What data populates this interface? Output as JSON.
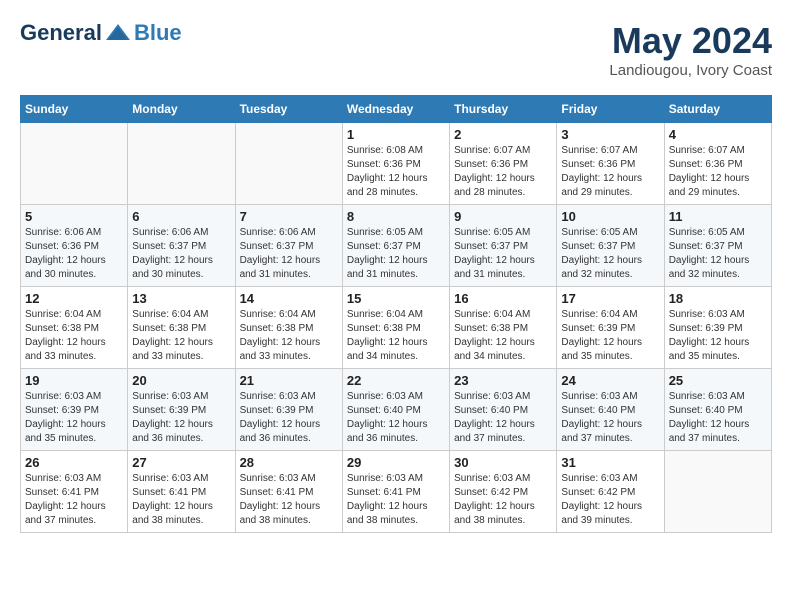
{
  "header": {
    "logo_general": "General",
    "logo_blue": "Blue",
    "month_year": "May 2024",
    "location": "Landiougou, Ivory Coast"
  },
  "days_of_week": [
    "Sunday",
    "Monday",
    "Tuesday",
    "Wednesday",
    "Thursday",
    "Friday",
    "Saturday"
  ],
  "weeks": [
    [
      {
        "day": "",
        "info": ""
      },
      {
        "day": "",
        "info": ""
      },
      {
        "day": "",
        "info": ""
      },
      {
        "day": "1",
        "info": "Sunrise: 6:08 AM\nSunset: 6:36 PM\nDaylight: 12 hours\nand 28 minutes."
      },
      {
        "day": "2",
        "info": "Sunrise: 6:07 AM\nSunset: 6:36 PM\nDaylight: 12 hours\nand 28 minutes."
      },
      {
        "day": "3",
        "info": "Sunrise: 6:07 AM\nSunset: 6:36 PM\nDaylight: 12 hours\nand 29 minutes."
      },
      {
        "day": "4",
        "info": "Sunrise: 6:07 AM\nSunset: 6:36 PM\nDaylight: 12 hours\nand 29 minutes."
      }
    ],
    [
      {
        "day": "5",
        "info": "Sunrise: 6:06 AM\nSunset: 6:36 PM\nDaylight: 12 hours\nand 30 minutes."
      },
      {
        "day": "6",
        "info": "Sunrise: 6:06 AM\nSunset: 6:37 PM\nDaylight: 12 hours\nand 30 minutes."
      },
      {
        "day": "7",
        "info": "Sunrise: 6:06 AM\nSunset: 6:37 PM\nDaylight: 12 hours\nand 31 minutes."
      },
      {
        "day": "8",
        "info": "Sunrise: 6:05 AM\nSunset: 6:37 PM\nDaylight: 12 hours\nand 31 minutes."
      },
      {
        "day": "9",
        "info": "Sunrise: 6:05 AM\nSunset: 6:37 PM\nDaylight: 12 hours\nand 31 minutes."
      },
      {
        "day": "10",
        "info": "Sunrise: 6:05 AM\nSunset: 6:37 PM\nDaylight: 12 hours\nand 32 minutes."
      },
      {
        "day": "11",
        "info": "Sunrise: 6:05 AM\nSunset: 6:37 PM\nDaylight: 12 hours\nand 32 minutes."
      }
    ],
    [
      {
        "day": "12",
        "info": "Sunrise: 6:04 AM\nSunset: 6:38 PM\nDaylight: 12 hours\nand 33 minutes."
      },
      {
        "day": "13",
        "info": "Sunrise: 6:04 AM\nSunset: 6:38 PM\nDaylight: 12 hours\nand 33 minutes."
      },
      {
        "day": "14",
        "info": "Sunrise: 6:04 AM\nSunset: 6:38 PM\nDaylight: 12 hours\nand 33 minutes."
      },
      {
        "day": "15",
        "info": "Sunrise: 6:04 AM\nSunset: 6:38 PM\nDaylight: 12 hours\nand 34 minutes."
      },
      {
        "day": "16",
        "info": "Sunrise: 6:04 AM\nSunset: 6:38 PM\nDaylight: 12 hours\nand 34 minutes."
      },
      {
        "day": "17",
        "info": "Sunrise: 6:04 AM\nSunset: 6:39 PM\nDaylight: 12 hours\nand 35 minutes."
      },
      {
        "day": "18",
        "info": "Sunrise: 6:03 AM\nSunset: 6:39 PM\nDaylight: 12 hours\nand 35 minutes."
      }
    ],
    [
      {
        "day": "19",
        "info": "Sunrise: 6:03 AM\nSunset: 6:39 PM\nDaylight: 12 hours\nand 35 minutes."
      },
      {
        "day": "20",
        "info": "Sunrise: 6:03 AM\nSunset: 6:39 PM\nDaylight: 12 hours\nand 36 minutes."
      },
      {
        "day": "21",
        "info": "Sunrise: 6:03 AM\nSunset: 6:39 PM\nDaylight: 12 hours\nand 36 minutes."
      },
      {
        "day": "22",
        "info": "Sunrise: 6:03 AM\nSunset: 6:40 PM\nDaylight: 12 hours\nand 36 minutes."
      },
      {
        "day": "23",
        "info": "Sunrise: 6:03 AM\nSunset: 6:40 PM\nDaylight: 12 hours\nand 37 minutes."
      },
      {
        "day": "24",
        "info": "Sunrise: 6:03 AM\nSunset: 6:40 PM\nDaylight: 12 hours\nand 37 minutes."
      },
      {
        "day": "25",
        "info": "Sunrise: 6:03 AM\nSunset: 6:40 PM\nDaylight: 12 hours\nand 37 minutes."
      }
    ],
    [
      {
        "day": "26",
        "info": "Sunrise: 6:03 AM\nSunset: 6:41 PM\nDaylight: 12 hours\nand 37 minutes."
      },
      {
        "day": "27",
        "info": "Sunrise: 6:03 AM\nSunset: 6:41 PM\nDaylight: 12 hours\nand 38 minutes."
      },
      {
        "day": "28",
        "info": "Sunrise: 6:03 AM\nSunset: 6:41 PM\nDaylight: 12 hours\nand 38 minutes."
      },
      {
        "day": "29",
        "info": "Sunrise: 6:03 AM\nSunset: 6:41 PM\nDaylight: 12 hours\nand 38 minutes."
      },
      {
        "day": "30",
        "info": "Sunrise: 6:03 AM\nSunset: 6:42 PM\nDaylight: 12 hours\nand 38 minutes."
      },
      {
        "day": "31",
        "info": "Sunrise: 6:03 AM\nSunset: 6:42 PM\nDaylight: 12 hours\nand 39 minutes."
      },
      {
        "day": "",
        "info": ""
      }
    ]
  ]
}
